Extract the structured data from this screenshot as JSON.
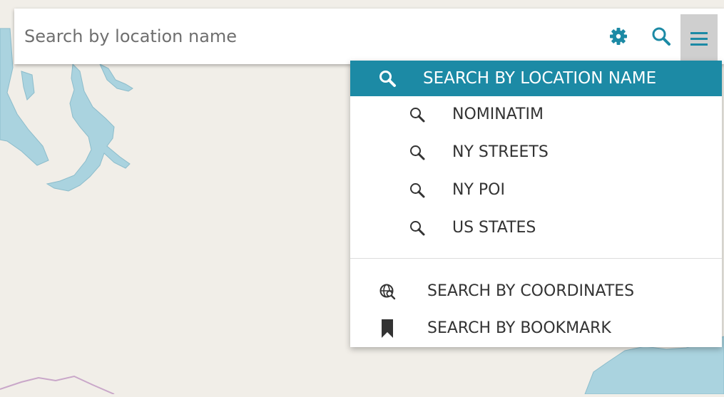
{
  "search": {
    "placeholder": "Search by location name",
    "value": ""
  },
  "toolbar": {
    "settings_icon": "gear-icon",
    "search_icon": "search-icon",
    "menu_icon": "hamburger-menu-icon",
    "accent_color": "#1c8aa5",
    "menu_button_bg": "#cfcfcf"
  },
  "dropdown": {
    "header": {
      "label": "SEARCH BY LOCATION NAME",
      "icon": "search-icon",
      "bg_color": "#1c8aa5"
    },
    "services": [
      {
        "label": "NOMINATIM",
        "icon": "search-icon"
      },
      {
        "label": "NY STREETS",
        "icon": "search-icon"
      },
      {
        "label": "NY POI",
        "icon": "search-icon"
      },
      {
        "label": "US STATES",
        "icon": "search-icon"
      }
    ],
    "modes": [
      {
        "label": "SEARCH BY COORDINATES",
        "icon": "globe-search-icon"
      },
      {
        "label": "SEARCH BY BOOKMARK",
        "icon": "bookmark-icon"
      }
    ]
  },
  "map": {
    "land_color": "#f1eee8",
    "water_color": "#aad3df"
  }
}
